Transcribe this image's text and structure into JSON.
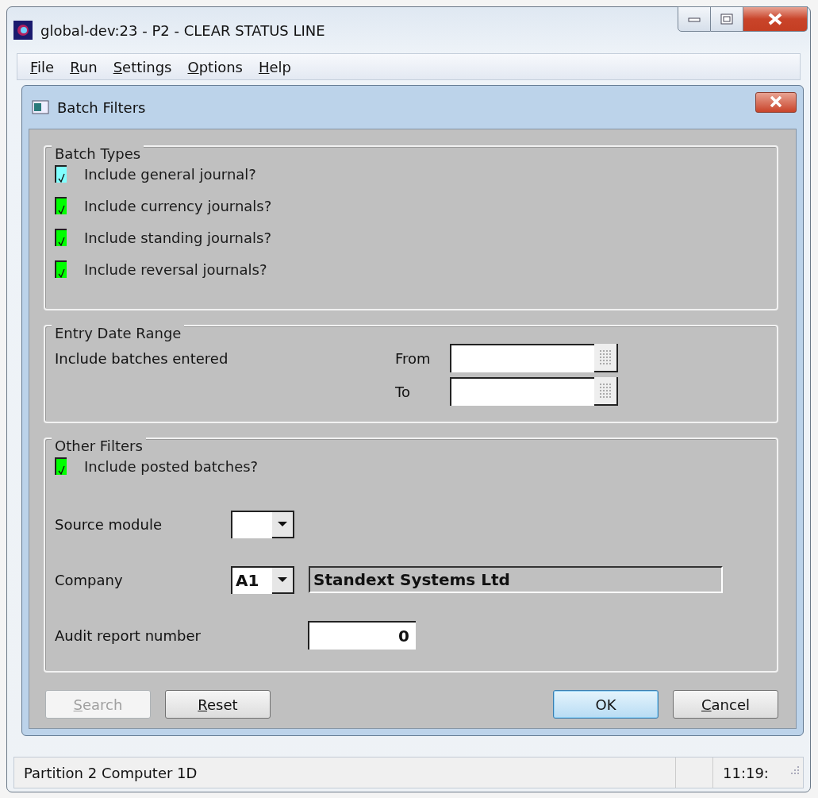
{
  "window": {
    "title": "global-dev:23 - P2 - CLEAR STATUS LINE"
  },
  "menu": [
    "File",
    "Run",
    "Settings",
    "Options",
    "Help"
  ],
  "dialog": {
    "title": "Batch Filters",
    "batch_types": {
      "title": "Batch Types",
      "options": [
        {
          "label": "Include general journal?",
          "checked": true,
          "focused": true
        },
        {
          "label": "Include currency journals?",
          "checked": true,
          "focused": false
        },
        {
          "label": "Include standing journals?",
          "checked": true,
          "focused": false
        },
        {
          "label": "Include reversal journals?",
          "checked": true,
          "focused": false
        }
      ]
    },
    "entry_date_range": {
      "title": "Entry Date Range",
      "label": "Include batches entered",
      "from_label": "From",
      "to_label": "To"
    },
    "other_filters": {
      "title": "Other Filters",
      "posted": {
        "label": "Include posted batches?",
        "checked": true,
        "focused": false
      },
      "source_module": {
        "label": "Source module"
      },
      "company": {
        "label": "Company",
        "value": "A1",
        "name": "Standext Systems Ltd"
      },
      "audit_report_number": {
        "label": "Audit report number",
        "value": "0"
      }
    },
    "buttons": [
      {
        "label": "Search",
        "disabled": true,
        "default": false
      },
      {
        "label": "Reset",
        "disabled": false,
        "default": false
      },
      {
        "label": "OK",
        "disabled": false,
        "default": true
      },
      {
        "label": "Cancel",
        "disabled": false,
        "default": false
      }
    ]
  },
  "status_bar": {
    "message": "Partition 2 Computer 1D",
    "time": "11:19:"
  }
}
